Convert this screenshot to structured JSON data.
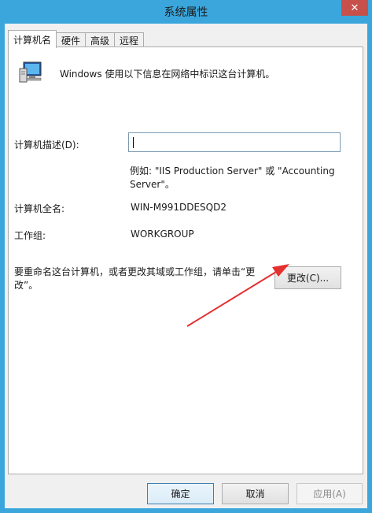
{
  "window": {
    "title": "系统属性",
    "close_glyph": "✕"
  },
  "tabs": [
    "计算机名",
    "硬件",
    "高级",
    "远程"
  ],
  "intro": "Windows 使用以下信息在网络中标识这台计算机。",
  "description": {
    "label": "计算机描述(D):",
    "value": "",
    "example_line1": "例如: \"IIS Production Server\" 或 \"Accounting",
    "example_line2": "Server\"。"
  },
  "full_name": {
    "label": "计算机全名:",
    "value": "WIN-M991DDESQD2"
  },
  "workgroup": {
    "label": "工作组:",
    "value": "WORKGROUP"
  },
  "rename": {
    "text_line1": "要重命名这台计算机，或者更改其域或工作组，请单击“更",
    "text_line2": "改”。",
    "button": "更改(C)..."
  },
  "footer": {
    "ok": "确定",
    "cancel": "取消",
    "apply": "应用(A)"
  },
  "colors": {
    "title_bar": "#3aa6dc",
    "close_button": "#c7504b",
    "annotation_arrow": "#e53030"
  },
  "icons": [
    "computer-icon",
    "close-icon"
  ]
}
